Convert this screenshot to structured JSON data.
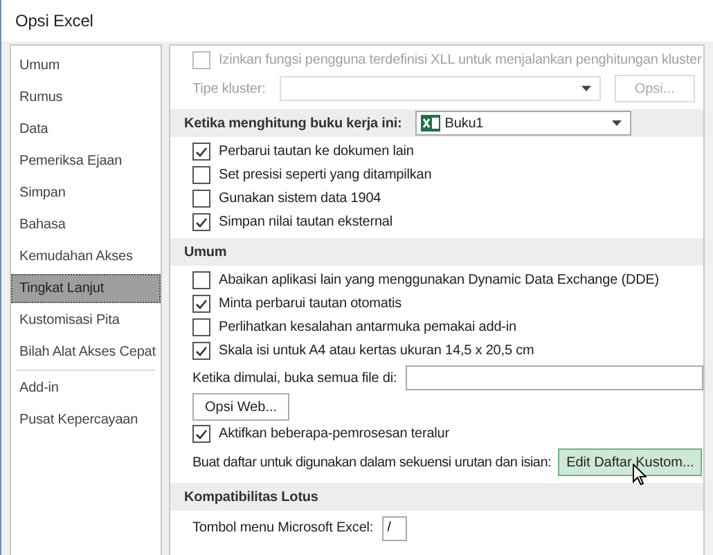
{
  "window": {
    "title": "Opsi Excel"
  },
  "sidebar": {
    "items": [
      {
        "label": "Umum",
        "selected": false
      },
      {
        "label": "Rumus",
        "selected": false
      },
      {
        "label": "Data",
        "selected": false
      },
      {
        "label": "Pemeriksa Ejaan",
        "selected": false
      },
      {
        "label": "Simpan",
        "selected": false
      },
      {
        "label": "Bahasa",
        "selected": false
      },
      {
        "label": "Kemudahan Akses",
        "selected": false
      },
      {
        "label": "Tingkat Lanjut",
        "selected": true
      },
      {
        "label": "Kustomisasi Pita",
        "selected": false
      },
      {
        "label": "Bilah Alat Akses Cepat",
        "selected": false,
        "divider_after": true
      },
      {
        "label": "Add-in",
        "selected": false
      },
      {
        "label": "Pusat Kepercayaan",
        "selected": false
      }
    ]
  },
  "sections": [
    {
      "items": [
        {
          "kind": "checkbox",
          "label": "Izinkan fungsi pengguna terdefinisi XLL untuk menjalankan penghitungan kluster",
          "checked": false,
          "disabled": true
        },
        {
          "kind": "select",
          "label": "Tipe kluster:",
          "disabled": true,
          "button": "Opsi..."
        }
      ]
    },
    {
      "title": "Ketika menghitung buku kerja ini:",
      "dropdown": {
        "value": "Buku1"
      },
      "items": [
        {
          "kind": "checkbox",
          "label": "Perbarui tautan ke dokumen lain",
          "checked": true
        },
        {
          "kind": "checkbox",
          "label": "Set presisi seperti yang ditampilkan",
          "checked": false
        },
        {
          "kind": "checkbox",
          "label": "Gunakan sistem data 1904",
          "checked": false
        },
        {
          "kind": "checkbox",
          "label": "Simpan nilai tautan eksternal",
          "checked": true
        }
      ]
    },
    {
      "title": "Umum",
      "items": [
        {
          "kind": "checkbox",
          "label": "Abaikan aplikasi lain yang menggunakan Dynamic Data Exchange (DDE)",
          "checked": false
        },
        {
          "kind": "checkbox",
          "label": "Minta perbarui tautan otomatis",
          "checked": true
        },
        {
          "kind": "checkbox",
          "label": "Perlihatkan kesalahan antarmuka pemakai add-in",
          "checked": false
        },
        {
          "kind": "checkbox",
          "label": "Skala isi untuk A4 atau kertas ukuran 14,5 x 20,5 cm",
          "checked": true
        },
        {
          "kind": "textfield",
          "label": "Ketika dimulai, buka semua file di:"
        },
        {
          "kind": "button",
          "button": "Opsi Web..."
        },
        {
          "kind": "checkbox",
          "label": "Aktifkan beberapa-pemrosesan teralur",
          "checked": true
        },
        {
          "kind": "labeled_button",
          "label": "Buat daftar untuk digunakan dalam sekuensi urutan dan isian:",
          "button": "Edit Daftar Kustom...",
          "hovered": true
        }
      ]
    },
    {
      "title": "Kompatibilitas Lotus",
      "items": [
        {
          "kind": "shortfield",
          "label": "Tombol menu Microsoft Excel:",
          "value": "/"
        }
      ]
    }
  ]
}
